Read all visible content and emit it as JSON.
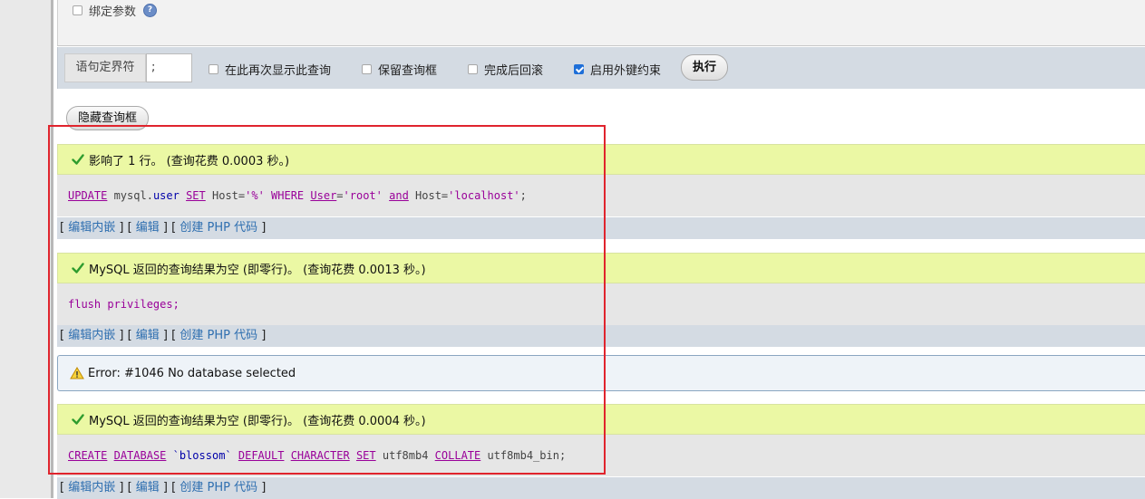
{
  "query_options": {
    "bind_params_label": "绑定参数",
    "delimiter_label": "语句定界符",
    "delimiter_value": ";",
    "show_again_label": "在此再次显示此查询",
    "keep_box_label": "保留查询框",
    "rollback_label": "完成后回滚",
    "fk_label": "启用外键约束",
    "execute_label": "执行"
  },
  "hide_box_label": "隐藏查询框",
  "link_labels": {
    "bracket_open": "[ ",
    "bracket_close": " ]",
    "sep": " ] [ ",
    "edit_inline": "编辑内嵌",
    "edit": "编辑",
    "create_php": "创建 PHP 代码"
  },
  "results": [
    {
      "message": "影响了 1 行。 (查询花费 0.0003 秒。)",
      "sql": {
        "t1": "UPDATE",
        "t2": " mysql.",
        "t3": "user",
        "t4": " ",
        "t5": "SET",
        "t6": " Host=",
        "t7": "'%'",
        "t8": " WHERE ",
        "t9": "User",
        "t10": "=",
        "t11": "'root'",
        "t12": " ",
        "t13": "and",
        "t14": " Host=",
        "t15": "'localhost'",
        "t16": ";"
      }
    },
    {
      "message": "MySQL 返回的查询结果为空 (即零行)。 (查询花费 0.0013 秒。)",
      "sql": {
        "t1": "flush privileges;"
      }
    },
    {
      "message": "MySQL 返回的查询结果为空 (即零行)。 (查询花费 0.0004 秒。)",
      "sql": {
        "t1": "CREATE",
        "t2": " ",
        "t3": "DATABASE",
        "t4": " `blossom` ",
        "t5": "DEFAULT",
        "t6": " ",
        "t7": "CHARACTER",
        "t8": " ",
        "t9": "SET",
        "t10": " utf8mb4 ",
        "t11": "COLLATE",
        "t12": " utf8mb4_bin;"
      }
    }
  ],
  "error": {
    "message": "Error: #1046 No database selected"
  },
  "icons": {
    "help": "help-icon",
    "success": "check-icon",
    "warning": "warning-icon"
  },
  "colors": {
    "success_bg": "#ebf8a4",
    "sql_bg": "#e6e6e6",
    "link": "#2f6fb0",
    "keyword": "#990099",
    "highlight_frame": "#e0242d"
  }
}
